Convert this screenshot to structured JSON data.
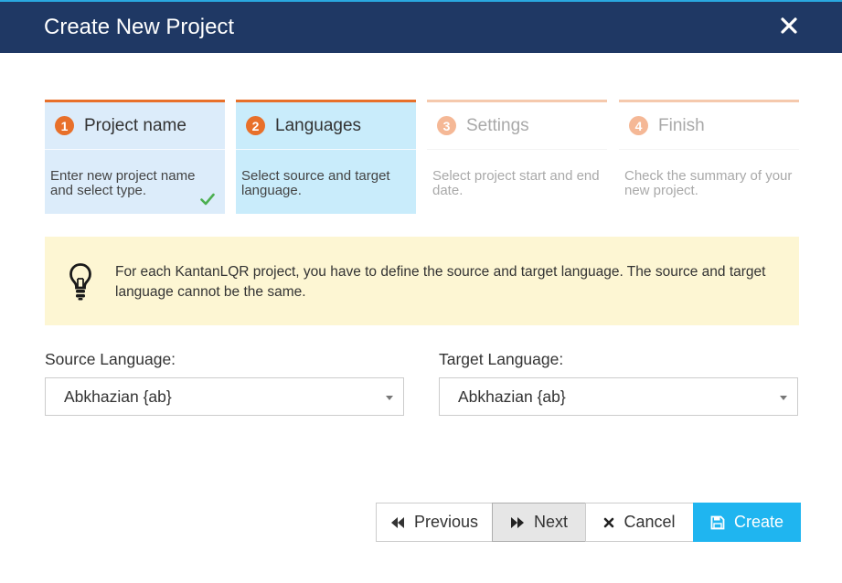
{
  "dialog": {
    "title": "Create New Project",
    "close_icon": "close-icon",
    "colors": {
      "header_bg": "#1f3864",
      "accent": "#e8702a",
      "primary_button": "#1fb5f0"
    }
  },
  "steps": [
    {
      "number": "1",
      "label": "Project name",
      "description": "Enter new project name and select type.",
      "state": "completed"
    },
    {
      "number": "2",
      "label": "Languages",
      "description": "Select source and target language.",
      "state": "active"
    },
    {
      "number": "3",
      "label": "Settings",
      "description": "Select project start and end date.",
      "state": "pending"
    },
    {
      "number": "4",
      "label": "Finish",
      "description": "Check the summary of your new project.",
      "state": "pending"
    }
  ],
  "tip": {
    "icon": "lightbulb-icon",
    "text": "For each KantanLQR project, you have to define the source and target language. The source and target language cannot be the same."
  },
  "form": {
    "source": {
      "label": "Source Language:",
      "value": "Abkhazian {ab}"
    },
    "target": {
      "label": "Target Language:",
      "value": "Abkhazian {ab}"
    }
  },
  "buttons": {
    "previous": "Previous",
    "next": "Next",
    "cancel": "Cancel",
    "create": "Create"
  }
}
